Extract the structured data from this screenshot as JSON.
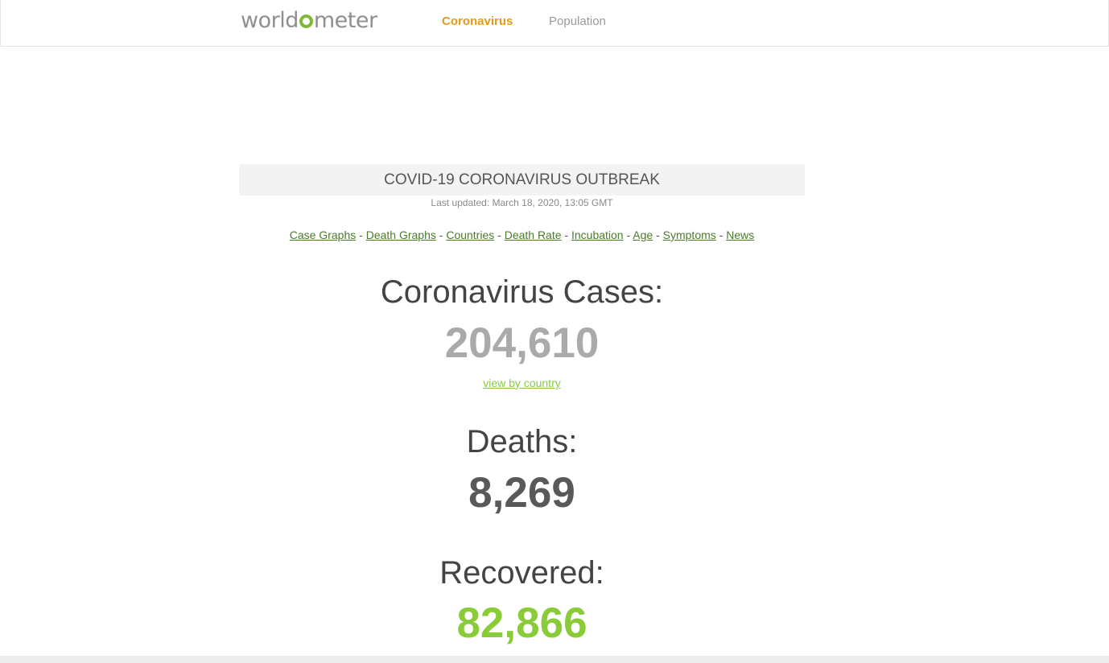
{
  "header": {
    "logo_prefix": "worldometer",
    "nav": [
      {
        "label": "Coronavirus",
        "active": true
      },
      {
        "label": "Population",
        "active": false
      }
    ]
  },
  "colors": {
    "brand_green": "#7eb936",
    "nav_active": "#e49b1b",
    "recovered_green": "#8acb38",
    "link_green": "#4a7b2a"
  },
  "outbreak": {
    "title": "COVID-19 CORONAVIRUS OUTBREAK",
    "last_updated": "Last updated: March 18, 2020, 13:05 GMT"
  },
  "subnav": [
    "Case Graphs",
    "Death Graphs",
    "Countries",
    "Death Rate",
    "Incubation",
    "Age",
    "Symptoms",
    "News"
  ],
  "stats": {
    "cases_label": "Coronavirus Cases:",
    "cases_value": "204,610",
    "view_by_country": "view by country",
    "deaths_label": "Deaths:",
    "deaths_value": "8,269",
    "recovered_label": "Recovered:",
    "recovered_value": "82,866"
  }
}
